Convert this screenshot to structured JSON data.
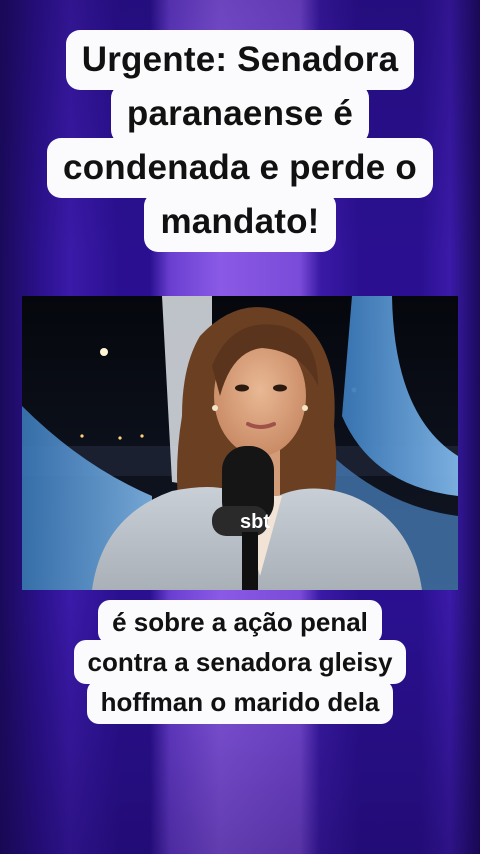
{
  "headline": {
    "lines": [
      "Urgente: Senadora",
      "paranaense é",
      "condenada e perde o",
      "mandato!"
    ]
  },
  "video": {
    "mic_logo_text": "sbt"
  },
  "caption": {
    "lines": [
      "é sobre a ação penal",
      "contra a senadora gleisy",
      "hoffman o marido dela"
    ]
  },
  "colors": {
    "background": "#2a0f86",
    "caption_box": "#fbfbfd",
    "text": "#111111"
  }
}
